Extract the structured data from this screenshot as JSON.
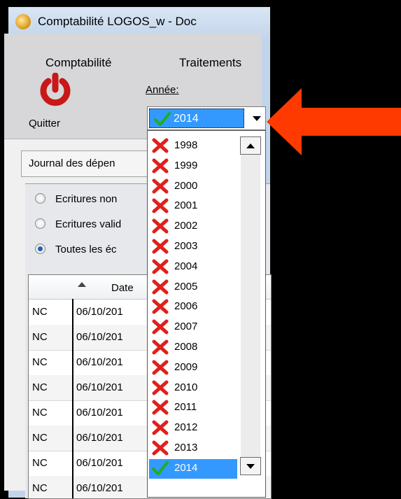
{
  "window": {
    "title": "Comptabilité LOGOS_w - Doc"
  },
  "menu": [
    {
      "label": "Comptabilité"
    },
    {
      "label": "Traitements"
    }
  ],
  "toolbar": {
    "quit_label": "Quitter",
    "annee_label": "Année:"
  },
  "year_combo": {
    "selected": "2014"
  },
  "tab": {
    "label": "Journal des dépen"
  },
  "filters": [
    {
      "label": "Ecritures non",
      "checked": false
    },
    {
      "label": "Ecritures valid",
      "checked": false
    },
    {
      "label": "Toutes les éc",
      "checked": true
    }
  ],
  "table": {
    "date_header": "Date",
    "rows": [
      {
        "type": "NC",
        "date": "06/10/201"
      },
      {
        "type": "NC",
        "date": "06/10/201"
      },
      {
        "type": "NC",
        "date": "06/10/201"
      },
      {
        "type": "NC",
        "date": "06/10/201"
      },
      {
        "type": "NC",
        "date": "06/10/201"
      },
      {
        "type": "NC",
        "date": "06/10/201"
      },
      {
        "type": "NC",
        "date": "06/10/201"
      },
      {
        "type": "NC",
        "date": "06/10/201"
      }
    ]
  },
  "year_list": [
    {
      "year": "1998",
      "status": "closed"
    },
    {
      "year": "1999",
      "status": "closed"
    },
    {
      "year": "2000",
      "status": "closed"
    },
    {
      "year": "2001",
      "status": "closed"
    },
    {
      "year": "2002",
      "status": "closed"
    },
    {
      "year": "2003",
      "status": "closed"
    },
    {
      "year": "2004",
      "status": "closed"
    },
    {
      "year": "2005",
      "status": "closed"
    },
    {
      "year": "2006",
      "status": "closed"
    },
    {
      "year": "2007",
      "status": "closed"
    },
    {
      "year": "2008",
      "status": "closed"
    },
    {
      "year": "2009",
      "status": "closed"
    },
    {
      "year": "2010",
      "status": "closed"
    },
    {
      "year": "2011",
      "status": "closed"
    },
    {
      "year": "2012",
      "status": "closed"
    },
    {
      "year": "2013",
      "status": "closed"
    },
    {
      "year": "2014",
      "status": "open",
      "selected": true
    }
  ],
  "colors": {
    "highlight": "#3399ff",
    "cross": "#e0201a",
    "check": "#1fae1f",
    "annotation_arrow": "#ff3a00"
  }
}
